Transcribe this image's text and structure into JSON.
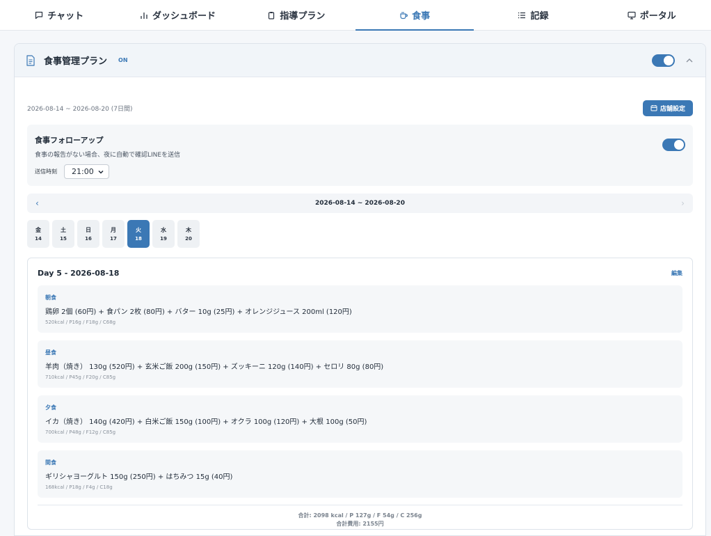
{
  "nav": {
    "tabs": [
      {
        "label": "チャット",
        "icon": "chat-icon"
      },
      {
        "label": "ダッシュボード",
        "icon": "bar-chart-icon"
      },
      {
        "label": "指導プラン",
        "icon": "clipboard-icon"
      },
      {
        "label": "食事",
        "icon": "cup-icon",
        "active": true
      },
      {
        "label": "記録",
        "icon": "list-icon"
      },
      {
        "label": "ポータル",
        "icon": "monitor-icon"
      }
    ]
  },
  "plan": {
    "title": "食事管理プラン",
    "status_badge": "ON",
    "enabled": true,
    "date_range": "2026-08-14 ~ 2026-08-20 (7日間)",
    "store_button": "店舗設定"
  },
  "followup": {
    "title": "食事フォローアップ",
    "description": "食事の報告がない場合、夜に自動で確認LINEを送信",
    "time_label": "送信時刻",
    "time_value": "21:00",
    "enabled": true
  },
  "week": {
    "label": "2026-08-14 ~ 2026-08-20",
    "days": [
      {
        "weekday": "金",
        "date": "14"
      },
      {
        "weekday": "土",
        "date": "15"
      },
      {
        "weekday": "日",
        "date": "16"
      },
      {
        "weekday": "月",
        "date": "17"
      },
      {
        "weekday": "火",
        "date": "18",
        "active": true
      },
      {
        "weekday": "水",
        "date": "19"
      },
      {
        "weekday": "木",
        "date": "20"
      }
    ]
  },
  "day": {
    "title": "Day 5 - 2026-08-18",
    "edit_label": "編集",
    "meals": [
      {
        "name": "朝食",
        "items": "鶏卵 2個 (60円) + 食パン 2枚 (80円) + バター 10g (25円) + オレンジジュース 200ml (120円)",
        "nutrition": "520kcal / P16g / F18g / C68g"
      },
      {
        "name": "昼食",
        "items": "羊肉（焼き） 130g (520円) + 玄米ご飯 200g (150円) + ズッキーニ 120g (140円) + セロリ 80g (80円)",
        "nutrition": "710kcal / P45g / F20g / C85g"
      },
      {
        "name": "夕食",
        "items": "イカ（焼き） 140g (420円) + 白米ご飯 150g (100円) + オクラ 100g (120円) + 大根 100g (50円)",
        "nutrition": "700kcal / P48g / F12g / C85g"
      },
      {
        "name": "間食",
        "items": "ギリシャヨーグルト 150g (250円) + はちみつ 15g (40円)",
        "nutrition": "168kcal / P18g / F4g / C18g"
      }
    ],
    "total_nutrition": "合計: 2098 kcal / P 127g / F 54g / C 256g",
    "total_cost": "合計費用: 2155円"
  },
  "colors": {
    "accent": "#3b78b5",
    "panel_bg": "#f5f7f9"
  }
}
